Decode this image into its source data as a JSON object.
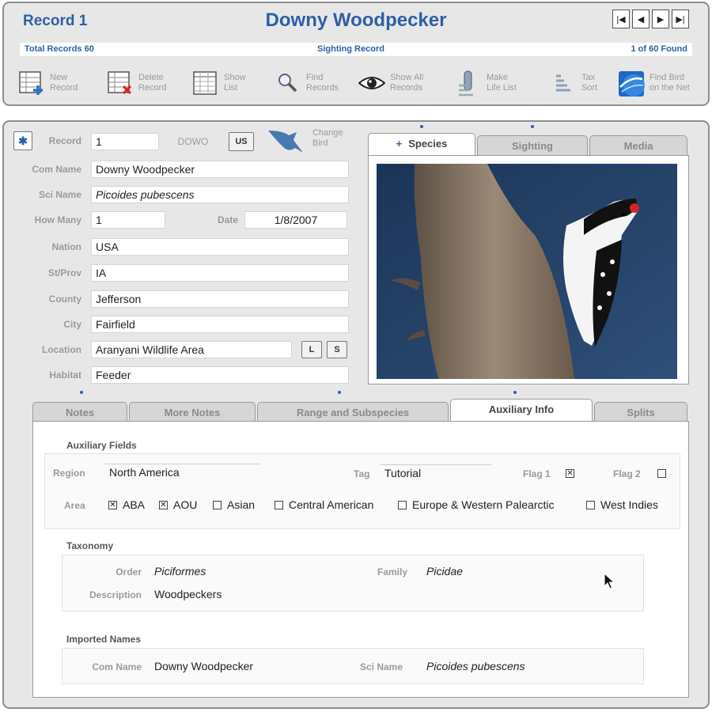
{
  "header": {
    "record_title": "Record 1",
    "species_title": "Downy Woodpecker",
    "total_records": "Total Records 60",
    "record_type": "Sighting Record",
    "found_status": "1 of 60 Found",
    "nav": [
      "first-icon",
      "prev-icon",
      "next-icon",
      "last-icon"
    ]
  },
  "toolbar": {
    "new_record": "New\nRecord",
    "delete_record": "Delete\nRecord",
    "show_list": "Show\nList",
    "find_records": "Find\nRecords",
    "show_all_records": "Show All\nRecords",
    "make_life_list": "Make\nLife List",
    "tax_sort": "Tax\nSort",
    "find_bird_net": "Find Bird\non the Net"
  },
  "form": {
    "record_label": "Record",
    "record_value": "1",
    "code": "DOWO",
    "us_button": "US",
    "change_bird": "Change\nBird",
    "com_name_label": "Com Name",
    "com_name": "Downy Woodpecker",
    "sci_name_label": "Sci Name",
    "sci_name": "Picoides pubescens",
    "how_many_label": "How Many",
    "how_many": "1",
    "date_label": "Date",
    "date": "1/8/2007",
    "nation_label": "Nation",
    "nation": "USA",
    "stprov_label": "St/Prov",
    "stprov": "IA",
    "county_label": "County",
    "county": "Jefferson",
    "city_label": "City",
    "city": "Fairfield",
    "location_label": "Location",
    "location": "Aranyani Wildlife Area",
    "location_l": "L",
    "location_s": "S",
    "habitat_label": "Habitat",
    "habitat": "Feeder"
  },
  "media_tabs": {
    "species": "Species",
    "sighting": "Sighting",
    "media": "Media",
    "active": "species"
  },
  "lower_tabs": {
    "notes": "Notes",
    "more_notes": "More Notes",
    "range": "Range and Subspecies",
    "auxiliary": "Auxiliary Info",
    "splits": "Splits",
    "active": "auxiliary"
  },
  "aux": {
    "section_title": "Auxiliary Fields",
    "region_label": "Region",
    "region": "North America",
    "tag_label": "Tag",
    "tag": "Tutorial",
    "flag1_label": "Flag 1",
    "flag1_checked": true,
    "flag2_label": "Flag 2",
    "flag2_checked": false,
    "area_label": "Area",
    "areas": [
      {
        "label": "ABA",
        "checked": true
      },
      {
        "label": "AOU",
        "checked": true
      },
      {
        "label": "Asian",
        "checked": false
      },
      {
        "label": "Central American",
        "checked": false
      },
      {
        "label": "Europe & Western Palearctic",
        "checked": false
      },
      {
        "label": "West Indies",
        "checked": false
      }
    ]
  },
  "taxonomy": {
    "section_title": "Taxonomy",
    "order_label": "Order",
    "order": "Piciformes",
    "family_label": "Family",
    "family": "Picidae",
    "description_label": "Description",
    "description": "Woodpeckers"
  },
  "imported": {
    "section_title": "Imported Names",
    "com_name_label": "Com Name",
    "com_name": "Downy Woodpecker",
    "sci_name_label": "Sci Name",
    "sci_name": "Picoides pubescens"
  },
  "colors": {
    "accent": "#2d5fa7",
    "panel_bg": "#e7e7e7",
    "label_gray": "#9a9a9a"
  }
}
